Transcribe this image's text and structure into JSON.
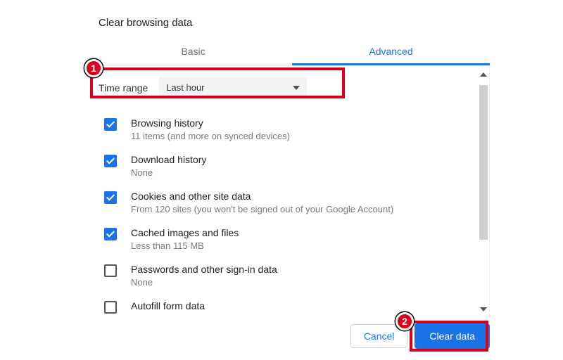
{
  "title": "Clear browsing data",
  "tabs": {
    "basic": "Basic",
    "advanced": "Advanced"
  },
  "range": {
    "label": "Time range",
    "value": "Last hour"
  },
  "items": [
    {
      "checked": true,
      "label": "Browsing history",
      "sub": "11 items (and more on synced devices)"
    },
    {
      "checked": true,
      "label": "Download history",
      "sub": "None"
    },
    {
      "checked": true,
      "label": "Cookies and other site data",
      "sub": "From 120 sites (you won't be signed out of your Google Account)"
    },
    {
      "checked": true,
      "label": "Cached images and files",
      "sub": "Less than 115 MB"
    },
    {
      "checked": false,
      "label": "Passwords and other sign-in data",
      "sub": "None"
    },
    {
      "checked": false,
      "label": "Autofill form data",
      "sub": ""
    }
  ],
  "buttons": {
    "cancel": "Cancel",
    "clear": "Clear data"
  },
  "annotations": {
    "one": "1",
    "two": "2"
  }
}
